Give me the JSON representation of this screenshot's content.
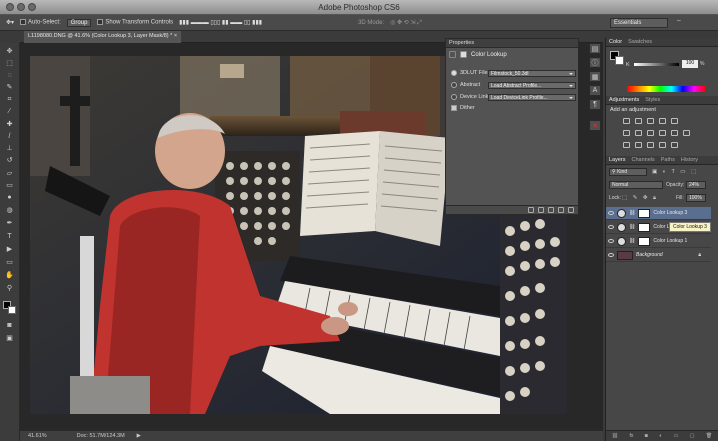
{
  "app": {
    "title": "Adobe Photoshop CS6"
  },
  "options_bar": {
    "auto_select_label": "Auto-Select:",
    "group_value": "Group",
    "show_transform_label": "Show Transform Controls",
    "mode_3d": "3D Mode:",
    "workspace": "Essentials"
  },
  "document": {
    "tab_title": "L1198080.DNG @ 41.6% (Color Lookup 3, Layer Mask/8) *",
    "zoom": "41.61%",
    "doc_size": "Doc: 51.7M/124.3M"
  },
  "properties": {
    "panel_tab": "Properties",
    "title": "Color Lookup",
    "rows": [
      {
        "label": "3DLUT File",
        "value": "Filmstock_50.3dl",
        "selected": true
      },
      {
        "label": "Abstract",
        "value": "Load Abstract Profile...",
        "selected": false
      },
      {
        "label": "Device Link",
        "value": "Load DeviceLink Profile...",
        "selected": false
      }
    ],
    "dither_label": "Dither",
    "dither_checked": true
  },
  "color_panel": {
    "tabs": [
      "Color",
      "Swatches"
    ],
    "channel": "K",
    "value": "100",
    "unit": "%"
  },
  "adjustments_panel": {
    "tabs": [
      "Adjustments",
      "Styles"
    ],
    "subtitle": "Add an adjustment"
  },
  "layers_panel": {
    "tabs": [
      "Layers",
      "Channels",
      "Paths",
      "History"
    ],
    "kind": "Kind",
    "blend_mode": "Normal",
    "opacity_label": "Opacity:",
    "opacity_value": "24%",
    "lock_label": "Lock:",
    "fill_label": "Fill:",
    "fill_value": "100%",
    "layers": [
      {
        "name": "Color Lookup 3",
        "selected": true
      },
      {
        "name": "Color Lookup 2",
        "selected": false
      },
      {
        "name": "Color Lookup 1",
        "selected": false
      },
      {
        "name": "Background",
        "selected": false
      }
    ],
    "tooltip": "Color Lookup 3",
    "footer_icons": [
      "link-icon",
      "fx-icon",
      "mask-icon",
      "adjustment-icon",
      "folder-icon",
      "new-layer-icon",
      "trash-icon"
    ]
  },
  "toolbar": {
    "tools": [
      "move-tool",
      "marquee-tool",
      "lasso-tool",
      "quick-select-tool",
      "crop-tool",
      "eyedropper-tool",
      "healing-tool",
      "brush-tool",
      "clone-stamp-tool",
      "history-brush-tool",
      "eraser-tool",
      "gradient-tool",
      "blur-tool",
      "dodge-tool",
      "pen-tool",
      "type-tool",
      "path-select-tool",
      "rectangle-tool",
      "hand-tool",
      "zoom-tool"
    ]
  }
}
